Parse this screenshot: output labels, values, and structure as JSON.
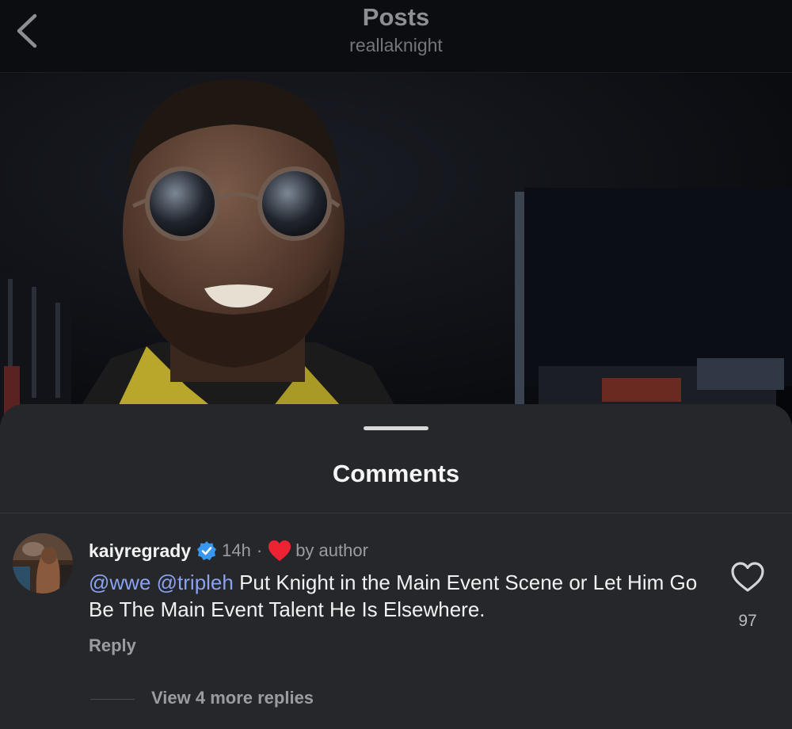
{
  "header": {
    "title": "Posts",
    "username": "reallaknight"
  },
  "sheet": {
    "title": "Comments"
  },
  "comment": {
    "username": "kaiyregrady",
    "time": "14h",
    "separator": "·",
    "liked_by": "by author",
    "mentions": [
      "@wwe",
      "@tripleh"
    ],
    "body": " Put Knight in the Main Event Scene or Let Him Go Be The Main Event Talent He Is Elsewhere.",
    "reply_label": "Reply",
    "like_count": "97",
    "view_replies": "View 4 more replies"
  },
  "colors": {
    "sheet_bg": "#26272b",
    "mention": "#8aa3f1",
    "verified": "#3897f0",
    "author_heart": "#ed2233"
  },
  "icons": {
    "back": "chevron-left-icon",
    "verified": "verified-badge-icon",
    "author_like": "heart-filled-icon",
    "like": "heart-outline-icon"
  }
}
